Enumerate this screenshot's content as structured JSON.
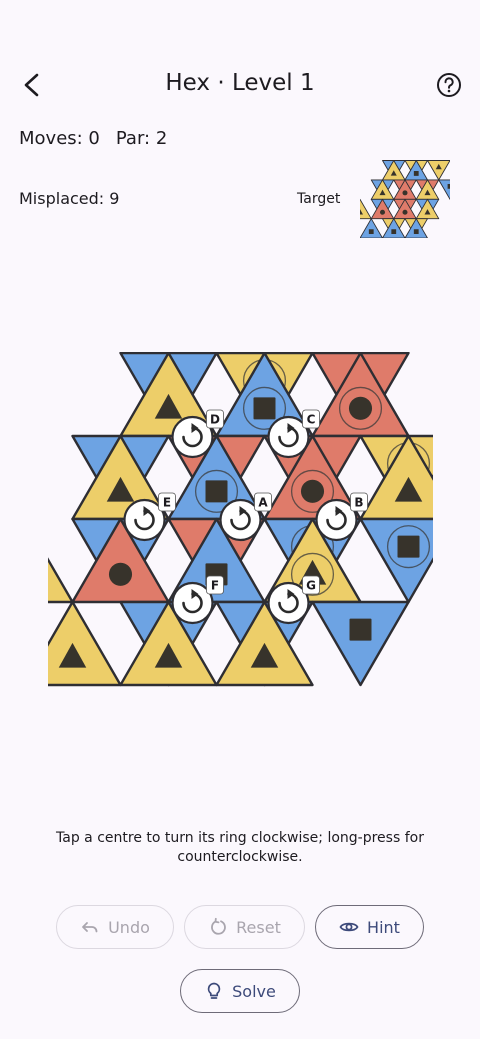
{
  "header": {
    "title": "Hex · Level 1",
    "back_icon": "arrow-back-icon",
    "help_icon": "help-circle-icon"
  },
  "stats": {
    "moves_label": "Moves: 0",
    "par_label": "Par: 2",
    "misplaced_label": "Misplaced: 9",
    "target_label": "Target"
  },
  "colors": {
    "yellow": "#edce69",
    "blue": "#6da3e3",
    "red": "#df7b6a",
    "outline": "#2e2e33",
    "symbol": "#37332b"
  },
  "board": {
    "rows": [
      [
        "blue:square",
        "yellow:triangle",
        "yellow:triangle*",
        "blue:square*",
        "red:circle",
        "red:circle*"
      ],
      [
        "blue:square",
        "yellow:triangle",
        "red:circle",
        "blue:square*",
        "red:circle",
        "red:circle*",
        "yellow:triangle*",
        "yellow:triangle"
      ],
      [
        "yellow:triangle",
        "blue:square",
        "red:circle",
        "red:circle",
        "blue:square",
        "blue:square*",
        "yellow:triangle*",
        "blue:square*"
      ],
      [
        "yellow:triangle",
        "blue:square",
        "yellow:triangle",
        "blue:square",
        "yellow:triangle",
        "blue:square"
      ]
    ],
    "centres": [
      {
        "label": "A",
        "icon": "rotate-clockwise-icon"
      },
      {
        "label": "B",
        "icon": "rotate-clockwise-icon"
      },
      {
        "label": "C",
        "icon": "rotate-clockwise-icon"
      },
      {
        "label": "D",
        "icon": "rotate-clockwise-icon"
      },
      {
        "label": "E",
        "icon": "rotate-clockwise-icon"
      },
      {
        "label": "F",
        "icon": "rotate-clockwise-icon"
      },
      {
        "label": "G",
        "icon": "rotate-clockwise-icon"
      }
    ]
  },
  "target": {
    "rows": [
      [
        "blue:square",
        "yellow:triangle",
        "yellow:triangle",
        "blue:square",
        "yellow:triangle"
      ],
      [
        "blue:square",
        "yellow:triangle",
        "red:circle",
        "red:circle",
        "red:circle",
        "yellow:triangle",
        "blue:square"
      ],
      [
        "yellow:triangle",
        "blue:square",
        "red:circle",
        "red:circle",
        "red:circle",
        "blue:square",
        "yellow:triangle"
      ],
      [
        "blue:square",
        "yellow:triangle",
        "blue:square",
        "yellow:triangle",
        "blue:square"
      ]
    ]
  },
  "instructions": "Tap a centre to turn its ring clockwise; long-press for counterclockwise.",
  "buttons": {
    "undo": {
      "label": "Undo",
      "icon": "undo-icon"
    },
    "reset": {
      "label": "Reset",
      "icon": "reset-icon"
    },
    "hint": {
      "label": "Hint",
      "icon": "eye-icon"
    },
    "solve": {
      "label": "Solve",
      "icon": "lightbulb-icon"
    }
  }
}
